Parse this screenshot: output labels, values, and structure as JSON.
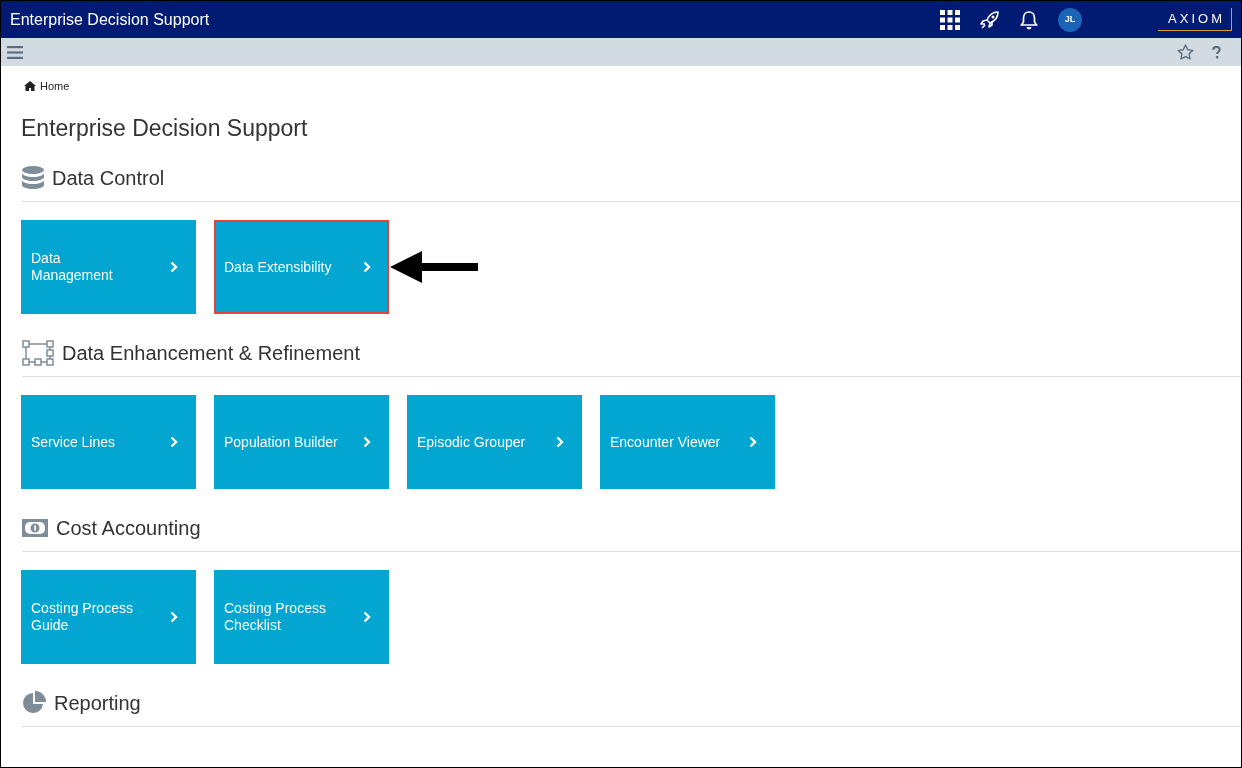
{
  "app_bar": {
    "title": "Enterprise Decision Support",
    "avatar": "JL",
    "logo": "AXIOM"
  },
  "breadcrumb": {
    "label": "Home"
  },
  "page_title": "Enterprise Decision Support",
  "sections": [
    {
      "title": "Data Control",
      "kind": "database",
      "tiles": [
        {
          "label": "Data Management",
          "highlighted": false
        },
        {
          "label": "Data Extensibility",
          "highlighted": true
        }
      ]
    },
    {
      "title": "Data Enhancement & Refinement",
      "kind": "diagram",
      "tiles": [
        {
          "label": "Service Lines",
          "highlighted": false
        },
        {
          "label": "Population Builder",
          "highlighted": false
        },
        {
          "label": "Episodic Grouper",
          "highlighted": false
        },
        {
          "label": "Encounter Viewer",
          "highlighted": false
        }
      ]
    },
    {
      "title": "Cost Accounting",
      "kind": "money",
      "tiles": [
        {
          "label": "Costing Process Guide",
          "highlighted": false
        },
        {
          "label": "Costing Process Checklist",
          "highlighted": false
        }
      ]
    },
    {
      "title": "Reporting",
      "kind": "pie"
    }
  ]
}
